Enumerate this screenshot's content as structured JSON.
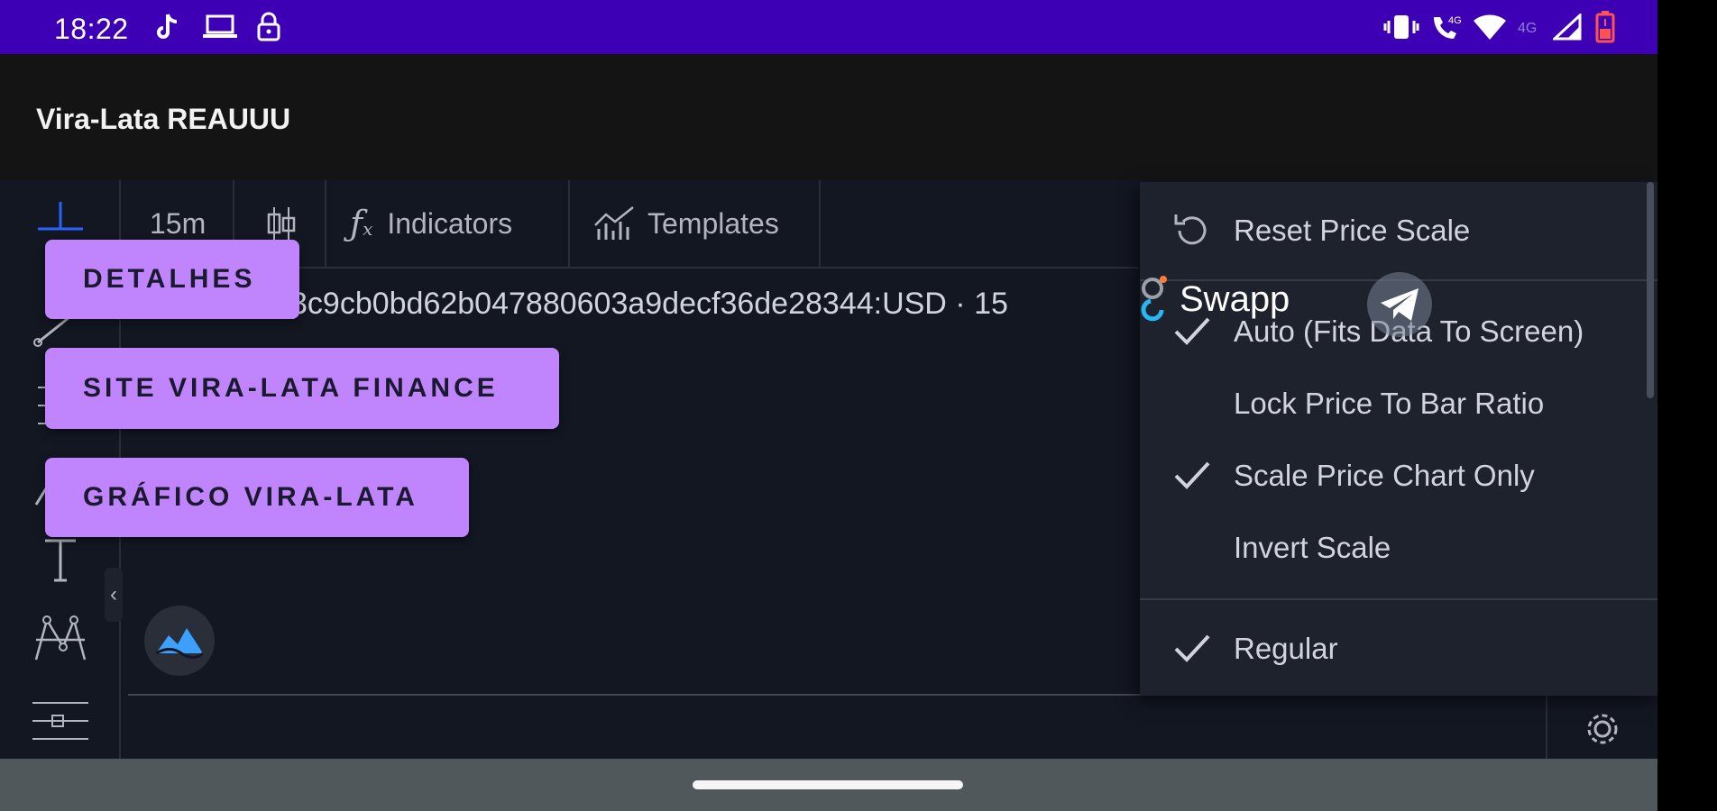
{
  "status_bar": {
    "time": "18:22",
    "left_icons": [
      "tiktok-icon",
      "laptop-icon",
      "lock-icon"
    ],
    "right_icons": [
      "vibrate-icon",
      "wifi-calling-icon",
      "wifi-icon",
      "network-icon",
      "signal-icon",
      "battery-low-icon"
    ],
    "network_label": "4G",
    "background_color": "#3d00b5"
  },
  "app_bar": {
    "title": "Vira-Lata REAUUU"
  },
  "chart_toolbar": {
    "interval": "15m",
    "chart_type_icon": "candles-icon",
    "indicators_label": "Indicators",
    "templates_label": "Templates"
  },
  "symbol": {
    "text": "3c9cb0bd62b047880603a9decf36de28344:USD · 15"
  },
  "overlay_buttons": [
    {
      "label": "DETALHES"
    },
    {
      "label": "SITE VIRA-LATA FINANCE"
    },
    {
      "label": "GRÁFICO VIRA-LATA"
    }
  ],
  "swapp": {
    "label": "Swapp"
  },
  "price_scale_menu": {
    "reset_label": "Reset Price Scale",
    "items": [
      {
        "label": "Auto (Fits Data To Screen)",
        "checked": true
      },
      {
        "label": "Lock Price To Bar Ratio",
        "checked": false
      },
      {
        "label": "Scale Price Chart Only",
        "checked": true
      },
      {
        "label": "Invert Scale",
        "checked": false
      }
    ],
    "scale_type_items": [
      {
        "label": "Regular",
        "checked": true
      }
    ]
  },
  "colors": {
    "accent_button": "#c084fc",
    "chart_background": "#131722",
    "menu_background": "#1e222d"
  }
}
